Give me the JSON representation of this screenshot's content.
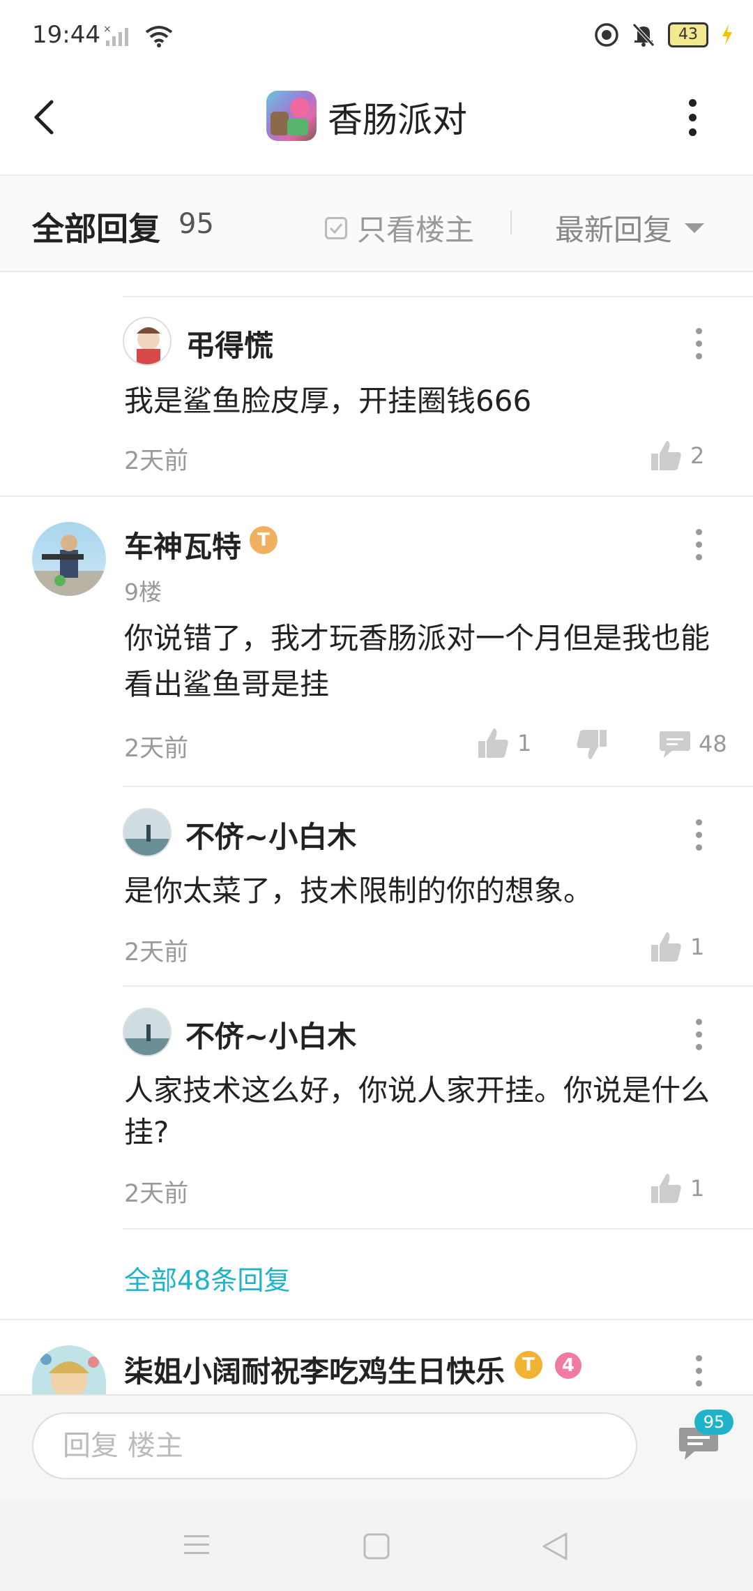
{
  "status_bar": {
    "time": "19:44",
    "battery": "43"
  },
  "header": {
    "title": "香肠派对",
    "back_icon": "chevron-left-icon",
    "more_icon": "more-vertical-icon"
  },
  "filter": {
    "all_label": "全部回复",
    "count": "95",
    "only_owner": "只看楼主",
    "sort_label": "最新回复"
  },
  "comments": [
    {
      "user": "弔得慌",
      "text": "我是鲨鱼脸皮厚，开挂圈钱666",
      "time": "2天前",
      "likes": "2"
    },
    {
      "user": "车神瓦特",
      "floor": "9楼",
      "badge": "T",
      "text_line1": "你说错了，我才玩香肠派对一个月但是我也能",
      "text_line2": "看出鲨鱼哥是挂",
      "time": "2天前",
      "likes": "1",
      "replies": "48",
      "sub_replies": [
        {
          "user": "不侪~小白木",
          "text": "是你太菜了，技术限制的你的想象。",
          "time": "2天前",
          "likes": "1"
        },
        {
          "user": "不侪~小白木",
          "text_line1": "人家技术这么好，你说人家开挂。你说是什么",
          "text_line2": "挂?",
          "time": "2天前",
          "likes": "1"
        }
      ],
      "all_replies_link": "全部48条回复"
    },
    {
      "user": "柒姐小阔耐祝李吃鸡生日快乐",
      "badge": "T",
      "level": "4"
    }
  ],
  "input": {
    "placeholder": "回复  楼主",
    "count_badge": "95"
  },
  "colors": {
    "accent": "#1fb2c9",
    "text": "#222222",
    "muted": "#999999"
  }
}
